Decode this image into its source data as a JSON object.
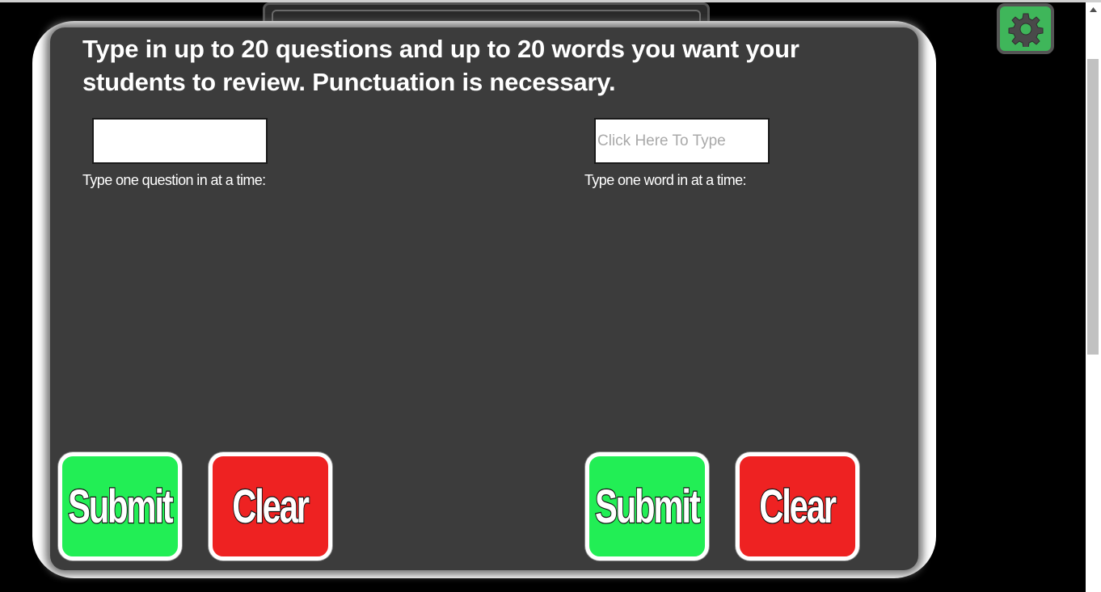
{
  "instructions": "Type in up to 20 questions and up to 20 words you want your students to review. Punctuation is necessary.",
  "question_section": {
    "input_value": "",
    "input_placeholder": "",
    "hint": "Type one question in at a time:",
    "submit_label": "Submit",
    "clear_label": "Clear"
  },
  "word_section": {
    "input_value": "",
    "input_placeholder": "Click Here To Type",
    "hint": "Type one word in at a time:",
    "submit_label": "Submit",
    "clear_label": "Clear"
  },
  "settings": {
    "icon": "gear-icon"
  },
  "colors": {
    "background": "#000000",
    "panel": "#3c3c3c",
    "panel_border": "#ffffff",
    "submit": "#22ee55",
    "clear": "#ee2222",
    "settings_button": "#3fb65a"
  }
}
